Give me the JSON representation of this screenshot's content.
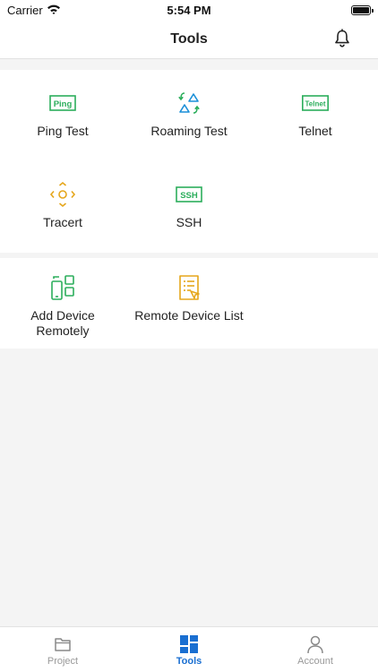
{
  "status_bar": {
    "carrier": "Carrier",
    "time": "5:54 PM"
  },
  "header": {
    "title": "Tools"
  },
  "tools_primary": [
    {
      "label": "Ping Test",
      "icon": "ping-icon",
      "icon_text": "Ping"
    },
    {
      "label": "Roaming Test",
      "icon": "roaming-icon"
    },
    {
      "label": "Telnet",
      "icon": "telnet-icon",
      "icon_text": "Telnet"
    },
    {
      "label": "Tracert",
      "icon": "tracert-icon"
    },
    {
      "label": "SSH",
      "icon": "ssh-icon",
      "icon_text": "SSH"
    }
  ],
  "tools_remote": [
    {
      "label": "Add Device\nRemotely",
      "icon": "add-device-icon"
    },
    {
      "label": "Remote Device List",
      "icon": "remote-list-icon"
    }
  ],
  "tabs": [
    {
      "label": "Project",
      "icon": "folder-icon",
      "active": false
    },
    {
      "label": "Tools",
      "icon": "grid-icon",
      "active": true
    },
    {
      "label": "Account",
      "icon": "person-icon",
      "active": false
    }
  ],
  "colors": {
    "green": "#2cae5c",
    "blue": "#1a8fd8",
    "yellow": "#e5a61b",
    "tab_active": "#1a6fd1",
    "tab_inactive": "#999999"
  }
}
